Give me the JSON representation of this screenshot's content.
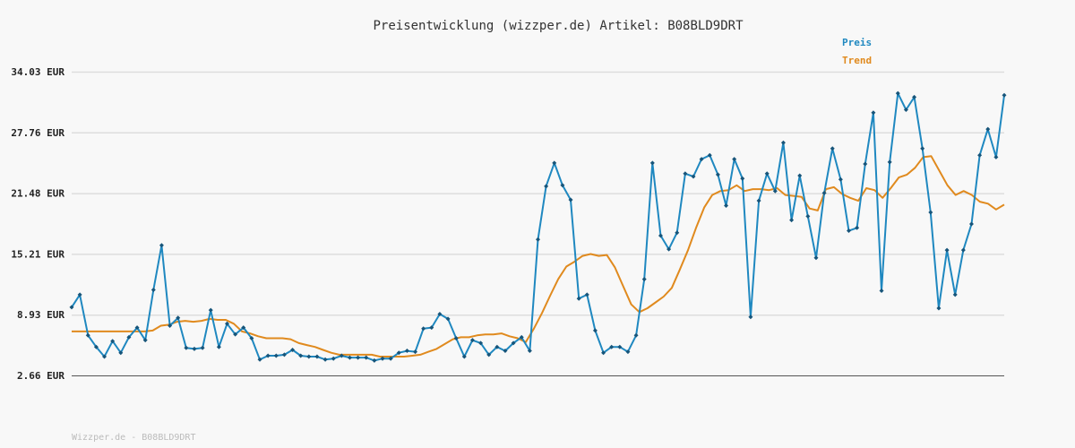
{
  "chart_data": {
    "type": "line",
    "title": "Preisentwicklung (wizzper.de) Artikel: B08BLD9DRT",
    "y_ticks": [
      "34.03 EUR",
      "27.76 EUR",
      "21.48 EUR",
      "15.21 EUR",
      "8.93 EUR",
      "2.66 EUR"
    ],
    "ylim": [
      2.66,
      34.03
    ],
    "grid": true,
    "legend_position": "top-right",
    "footer": "Wizzper.de - B08BLD9DRT",
    "series": [
      {
        "name": "Preis",
        "color": "#1f88c0",
        "markers": true,
        "values": [
          9.7,
          11.0,
          6.8,
          5.6,
          4.6,
          6.2,
          5.0,
          6.6,
          7.6,
          6.3,
          11.5,
          16.1,
          7.8,
          8.6,
          5.5,
          5.4,
          5.5,
          9.4,
          5.6,
          8.0,
          6.9,
          7.6,
          6.5,
          4.3,
          4.7,
          4.7,
          4.8,
          5.3,
          4.7,
          4.6,
          4.6,
          4.3,
          4.4,
          4.7,
          4.5,
          4.5,
          4.5,
          4.2,
          4.4,
          4.4,
          5.0,
          5.2,
          5.1,
          7.5,
          7.6,
          9.0,
          8.5,
          6.5,
          4.6,
          6.3,
          6.0,
          4.8,
          5.6,
          5.2,
          6.0,
          6.6,
          5.2,
          16.7,
          22.2,
          24.6,
          22.3,
          20.8,
          10.6,
          11.0,
          7.3,
          5.0,
          5.6,
          5.6,
          5.1,
          6.8,
          12.6,
          24.6,
          17.1,
          15.7,
          17.4,
          23.5,
          23.2,
          25.0,
          25.4,
          23.4,
          20.2,
          25.0,
          23.0,
          8.7,
          20.7,
          23.5,
          21.7,
          26.7,
          18.7,
          23.3,
          19.1,
          14.8,
          21.5,
          26.1,
          22.9,
          17.6,
          17.9,
          24.5,
          29.8,
          11.4,
          24.7,
          31.8,
          30.1,
          31.4,
          26.1,
          19.5,
          9.6,
          15.6,
          11.0,
          15.6,
          18.3,
          25.4,
          28.1,
          25.2,
          31.6
        ]
      },
      {
        "name": "Trend",
        "color": "#e08a1e",
        "markers": false,
        "values": [
          7.2,
          7.2,
          7.2,
          7.2,
          7.2,
          7.2,
          7.2,
          7.2,
          7.2,
          7.2,
          7.3,
          7.8,
          7.9,
          8.2,
          8.3,
          8.2,
          8.3,
          8.5,
          8.4,
          8.4,
          8.0,
          7.2,
          7.0,
          6.7,
          6.5,
          6.5,
          6.5,
          6.4,
          6.0,
          5.8,
          5.6,
          5.3,
          5.0,
          4.8,
          4.8,
          4.8,
          4.8,
          4.8,
          4.6,
          4.6,
          4.6,
          4.6,
          4.7,
          4.8,
          5.1,
          5.4,
          5.9,
          6.4,
          6.6,
          6.6,
          6.8,
          6.9,
          6.9,
          7.0,
          6.7,
          6.5,
          6.1,
          7.5,
          9.1,
          10.9,
          12.6,
          13.9,
          14.4,
          15.0,
          15.2,
          15.0,
          15.1,
          13.8,
          11.9,
          10.0,
          9.2,
          9.6,
          10.2,
          10.8,
          11.7,
          13.6,
          15.6,
          17.9,
          20.0,
          21.3,
          21.7,
          21.8,
          22.3,
          21.7,
          21.9,
          21.9,
          21.8,
          22.0,
          21.3,
          21.2,
          21.1,
          19.9,
          19.7,
          21.9,
          22.1,
          21.4,
          21.0,
          20.7,
          22.0,
          21.8,
          21.0,
          22.0,
          23.1,
          23.4,
          24.1,
          25.2,
          25.3,
          23.8,
          22.3,
          21.3,
          21.7,
          21.3,
          20.6,
          20.4,
          19.8,
          20.3
        ]
      }
    ]
  }
}
